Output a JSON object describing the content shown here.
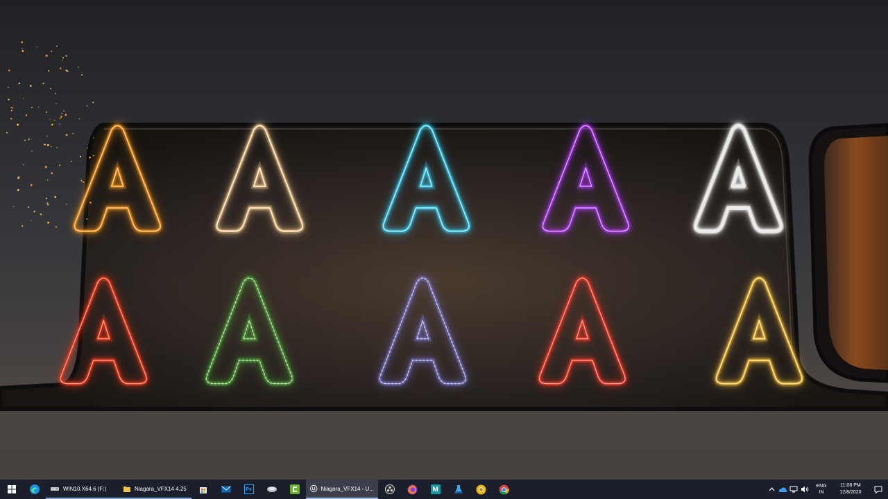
{
  "scene": {
    "letter": "A",
    "effects": [
      {
        "name": "orange-sparks-letter",
        "color": "#ff9a1f"
      },
      {
        "name": "orange-glow-letter",
        "color": "#ffd59a"
      },
      {
        "name": "cyan-electric-letter",
        "color": "#3fd8ff"
      },
      {
        "name": "purple-neon-letter",
        "color": "#b33cff"
      },
      {
        "name": "white-smoke-letter",
        "color": "#e6e6e6"
      },
      {
        "name": "red-fire-letter",
        "color": "#ff3a1a"
      },
      {
        "name": "green-particle-letter",
        "color": "#5fd44a"
      },
      {
        "name": "blue-dotted-letter",
        "color": "#8f8cff"
      },
      {
        "name": "red-neon-letter",
        "color": "#ff3b2a"
      },
      {
        "name": "yellow-neon-letter",
        "color": "#ffc640"
      }
    ]
  },
  "taskbar": {
    "tasks": [
      {
        "label": "WIN10.X64.6 (F:)",
        "icon": "drive-icon"
      },
      {
        "label": "Niagara_VFX14 4.25",
        "icon": "folder-icon"
      },
      {
        "label": "Niagara_VFX14 - U...",
        "icon": "unreal-icon"
      }
    ],
    "pinned": [
      "store-icon",
      "mail-icon",
      "photoshop-icon",
      "network-drive-icon",
      "camtasia-icon"
    ],
    "pinned_after": [
      "obs-icon",
      "firefox-icon",
      "maya-icon",
      "flask-icon",
      "chrome-canary-icon",
      "chrome-icon"
    ],
    "photoshop_text": "Ps",
    "maya_text": "M",
    "lang_top": "ENG",
    "lang_bottom": "IN",
    "time": "11:08 PM",
    "date": "12/8/2020"
  }
}
